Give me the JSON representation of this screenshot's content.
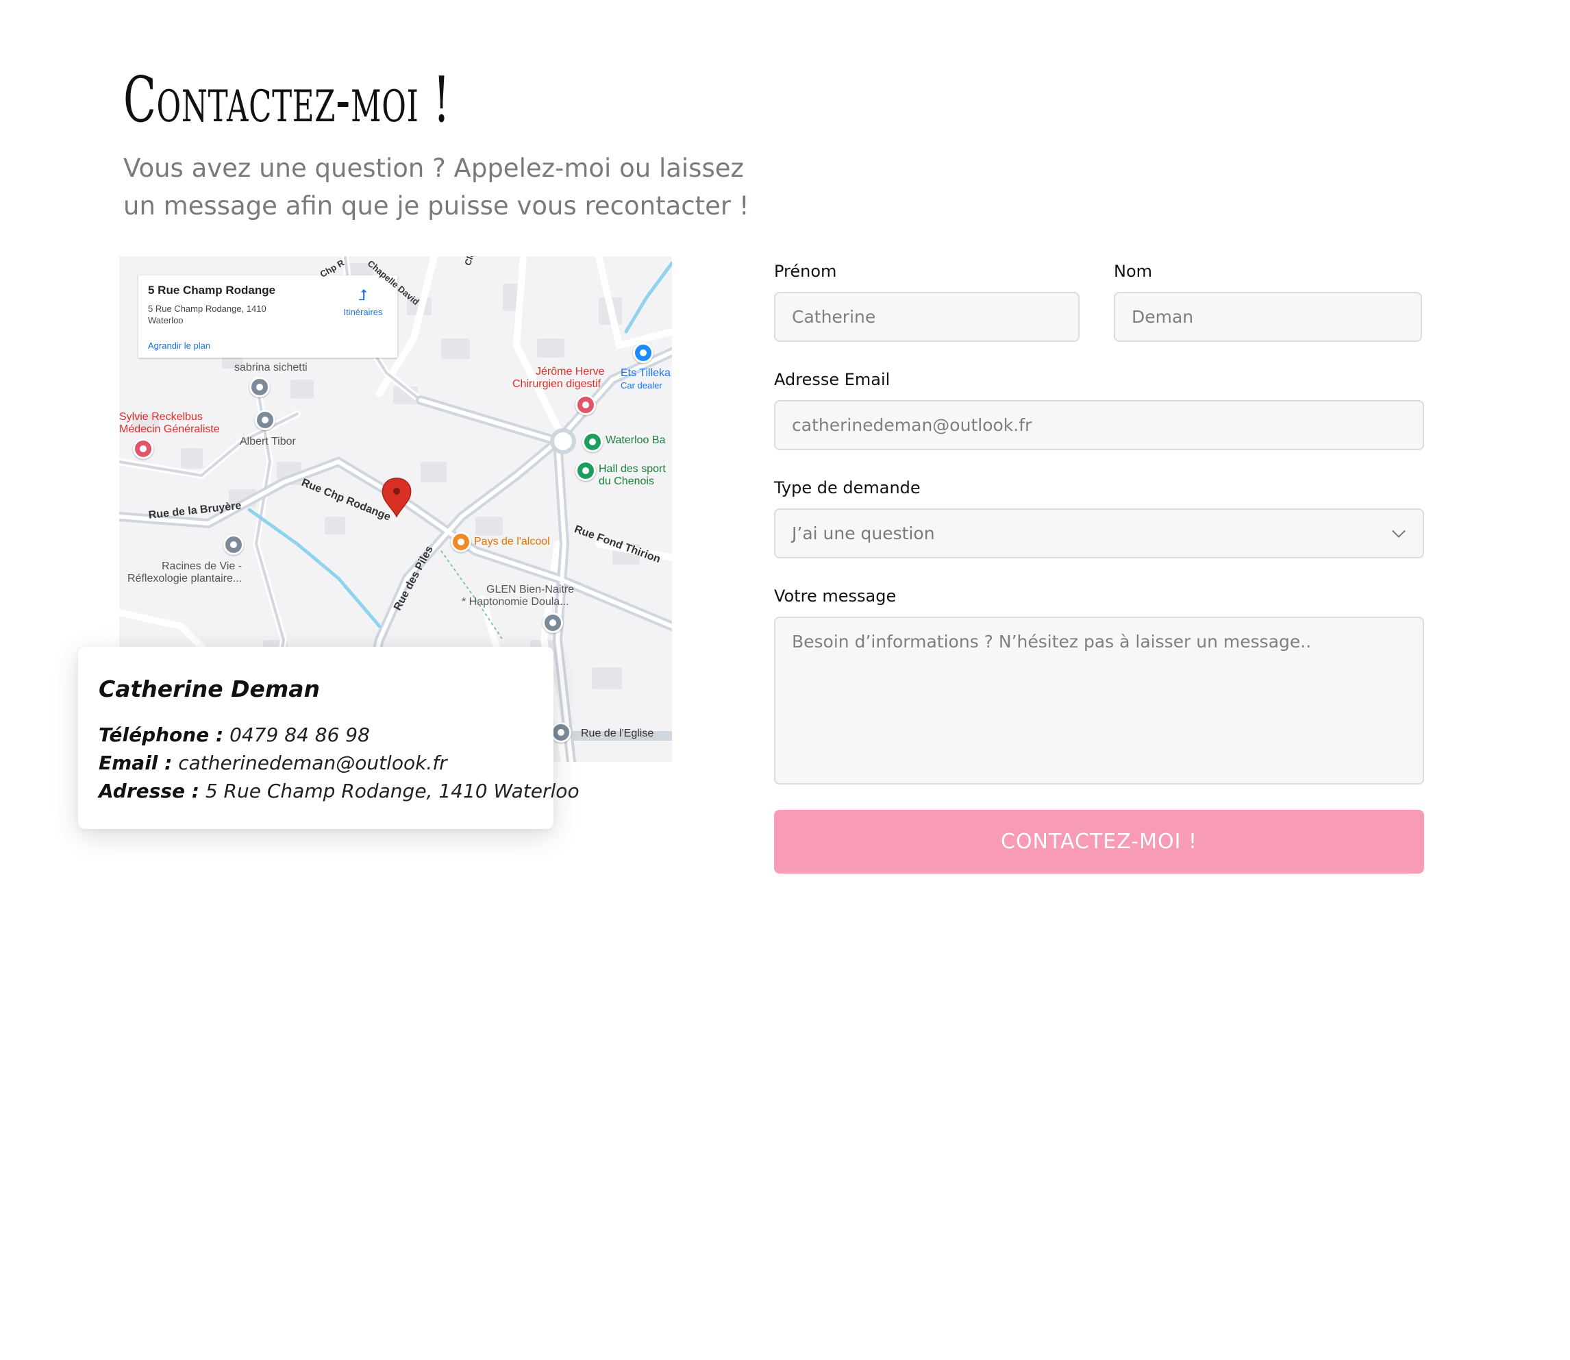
{
  "header": {
    "title": "Contactez-moi !",
    "subtitle": "Vous avez une question ? Appelez-moi ou laissez un message afin que je puisse vous recontacter !"
  },
  "map": {
    "card_title": "5 Rue Champ Rodange",
    "card_address": "5 Rue Champ Rodange, 1410 Waterloo",
    "directions_label": "Itinéraires",
    "enlarge_link": "Agrandir le plan",
    "labels": {
      "sabrina": "sabrina sichetti",
      "sylvie_1": "Sylvie Reckelbus",
      "sylvie_2": "Médecin Généraliste",
      "albert": "Albert Tibor",
      "jerome_1": "Jérôme Herve",
      "jerome_2": "Chirurgien digestif",
      "ets_1": "Ets Tilleka",
      "ets_2": "Car dealer",
      "waterloo_ba": "Waterloo Ba",
      "hall_1": "Hall des sport",
      "hall_2": "du Chenois",
      "rue_chp": "Rue Chp Rodange",
      "rue_bruyere": "Rue de la Bruyère",
      "pays_alcool": "Pays de l'alcool",
      "rue_fond": "Rue Fond Thirion",
      "racines_1": "Racines de Vie -",
      "racines_2": "Réflexologie plantaire...",
      "rue_piles": "Rue des Piles",
      "glen_1": "GLEN Bien-Naitre",
      "glen_2": "* Haptonomie Doula...",
      "rue_eglise": "Rue de l'Eglise",
      "clos": "Clos",
      "chapelle": "Chapelle David",
      "chp": "Chp R"
    }
  },
  "contact": {
    "name": "Catherine Deman",
    "phone_label": "Téléphone :",
    "phone": "0479 84 86 98",
    "email_label": "Email :",
    "email": "catherinedeman@outlook.fr",
    "address_label": "Adresse :",
    "address": "5 Rue Champ Rodange, 1410 Waterloo"
  },
  "form": {
    "firstname_label": "Prénom",
    "firstname_placeholder": "Catherine",
    "lastname_label": "Nom",
    "lastname_placeholder": "Deman",
    "email_label": "Adresse Email",
    "email_placeholder": "catherinedeman@outlook.fr",
    "type_label": "Type de demande",
    "type_value": "J’ai une question",
    "message_label": "Votre message",
    "message_placeholder": "Besoin d’informations ? N’hésitez pas à laisser un message..",
    "submit_label": "CONTACTEZ-MOI !"
  },
  "colors": {
    "accent": "#f79bb6",
    "map_pin": "#d93025",
    "field_bg": "#f7f7f8"
  }
}
